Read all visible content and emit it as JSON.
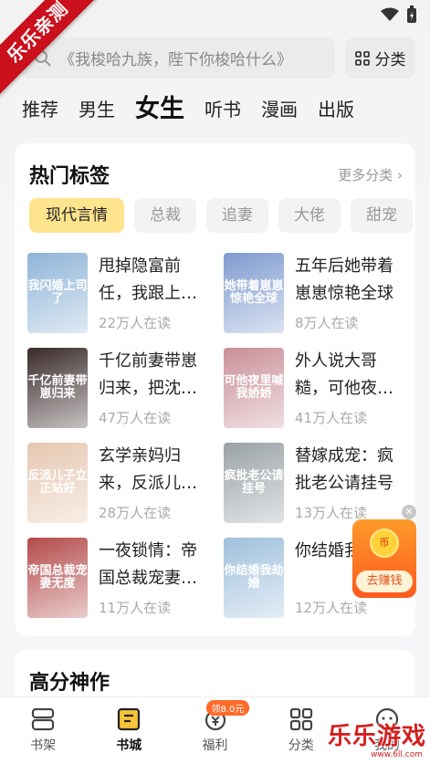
{
  "watermark_corner": "乐乐亲测",
  "search": {
    "placeholder": "《我梭哈九族，陛下你梭哈什么》"
  },
  "category_button": "分类",
  "nav_tabs": [
    "推荐",
    "男生",
    "女生",
    "听书",
    "漫画",
    "出版"
  ],
  "active_tab": "女生",
  "hot_tags": {
    "title": "热门标签",
    "more": "更多分类 ›",
    "chips": [
      "现代言情",
      "总裁",
      "追妻",
      "大佬",
      "甜宠"
    ]
  },
  "books": [
    {
      "title": "甩掉隐富前任，我跟上…",
      "readers": "22万人在读",
      "cover_text": "我闪婚上司了",
      "color": "#8fb4d8"
    },
    {
      "title": "五年后她带着崽崽惊艳全球",
      "readers": "8万人在读",
      "cover_text": "她带着崽崽惊艳全球",
      "color": "#7f9bcf"
    },
    {
      "title": "千亿前妻带崽归来，把沈…",
      "readers": "47万人在读",
      "cover_text": "千亿前妻带崽归来",
      "color": "#3a2a2a"
    },
    {
      "title": "外人说大哥糙，可他夜…",
      "readers": "41万人在读",
      "cover_text": "可他夜里喊我娇娇",
      "color": "#c98f98"
    },
    {
      "title": "玄学亲妈归来，反派儿…",
      "readers": "28万人在读",
      "cover_text": "反派儿子立正站好",
      "color": "#e6c7b0"
    },
    {
      "title": "替嫁成宠：疯批老公请挂号",
      "readers": "13万人在读",
      "cover_text": "疯批老公请挂号",
      "color": "#9aa2a6"
    },
    {
      "title": "一夜锁情：帝国总裁宠妻…",
      "readers": "11万人在读",
      "cover_text": "帝国总裁宠妻无度",
      "color": "#b44a4a"
    },
    {
      "title": "你结婚我…",
      "readers": "12万人在读",
      "cover_text": "你结婚我劫婚",
      "color": "#9fc0dc"
    }
  ],
  "section2_title": "高分神作",
  "promo": {
    "coin": "币",
    "label": "去赚钱"
  },
  "bottom_nav": [
    {
      "label": "书架",
      "icon": "bookshelf-icon"
    },
    {
      "label": "书城",
      "icon": "bookstore-icon"
    },
    {
      "label": "福利",
      "icon": "welfare-icon",
      "badge": "领8.0元"
    },
    {
      "label": "分类",
      "icon": "category-icon"
    },
    {
      "label": "我的",
      "icon": "profile-icon"
    }
  ],
  "active_bottom": "书城",
  "watermark_brand": "乐乐游戏",
  "watermark_url": "www.6ll.com"
}
